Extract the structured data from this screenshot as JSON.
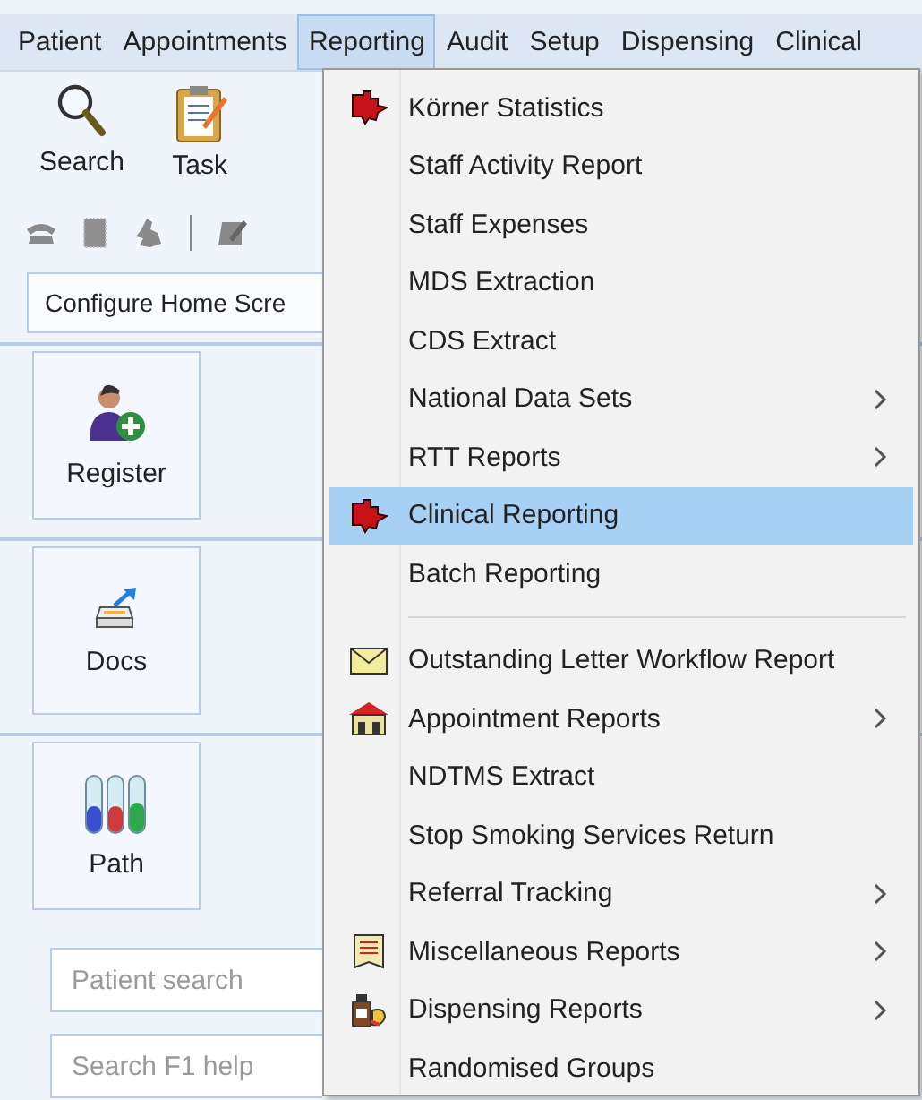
{
  "menubar": [
    {
      "label": "Patient",
      "selected": false
    },
    {
      "label": "Appointments",
      "selected": false
    },
    {
      "label": "Reporting",
      "selected": true
    },
    {
      "label": "Audit",
      "selected": false
    },
    {
      "label": "Setup",
      "selected": false
    },
    {
      "label": "Dispensing",
      "selected": false
    },
    {
      "label": "Clinical",
      "selected": false
    }
  ],
  "toolbar": [
    {
      "label": "Search",
      "kind": "search"
    },
    {
      "label": "Task",
      "kind": "task"
    }
  ],
  "configure_field": {
    "value": "Configure Home Scre"
  },
  "tiles": [
    {
      "label": "Register",
      "kind": "register"
    },
    {
      "label": "Docs",
      "kind": "docs"
    },
    {
      "label": "Path",
      "kind": "path"
    }
  ],
  "search_fields": [
    {
      "placeholder": "Patient search"
    },
    {
      "placeholder": "Search F1 help"
    }
  ],
  "reporting_menu": [
    {
      "kind": "puzzle",
      "label": "Körner Statistics",
      "submenu": false,
      "selected": false
    },
    {
      "kind": "plain",
      "label": "Staff Activity Report",
      "submenu": false,
      "selected": false
    },
    {
      "kind": "plain",
      "label": "Staff Expenses",
      "submenu": false,
      "selected": false
    },
    {
      "kind": "plain",
      "label": "MDS Extraction",
      "submenu": false,
      "selected": false
    },
    {
      "kind": "plain",
      "label": "CDS Extract",
      "submenu": false,
      "selected": false
    },
    {
      "kind": "plain",
      "label": "National Data Sets",
      "submenu": true,
      "selected": false
    },
    {
      "kind": "plain",
      "label": "RTT Reports",
      "submenu": true,
      "selected": false
    },
    {
      "kind": "puzzle",
      "label": "Clinical Reporting",
      "submenu": false,
      "selected": true
    },
    {
      "kind": "plain",
      "label": "Batch Reporting",
      "submenu": false,
      "selected": false
    },
    {
      "kind": "separator"
    },
    {
      "kind": "letter",
      "label": "Outstanding Letter Workflow Report",
      "submenu": false,
      "selected": false
    },
    {
      "kind": "house",
      "label": "Appointment Reports",
      "submenu": true,
      "selected": false
    },
    {
      "kind": "plain",
      "label": "NDTMS Extract",
      "submenu": false,
      "selected": false
    },
    {
      "kind": "plain",
      "label": "Stop Smoking Services Return",
      "submenu": false,
      "selected": false
    },
    {
      "kind": "plain",
      "label": "Referral Tracking",
      "submenu": true,
      "selected": false
    },
    {
      "kind": "report",
      "label": "Miscellaneous Reports",
      "submenu": true,
      "selected": false
    },
    {
      "kind": "bottle",
      "label": "Dispensing Reports",
      "submenu": true,
      "selected": false
    },
    {
      "kind": "plain",
      "label": "Randomised Groups",
      "submenu": false,
      "selected": false
    }
  ]
}
